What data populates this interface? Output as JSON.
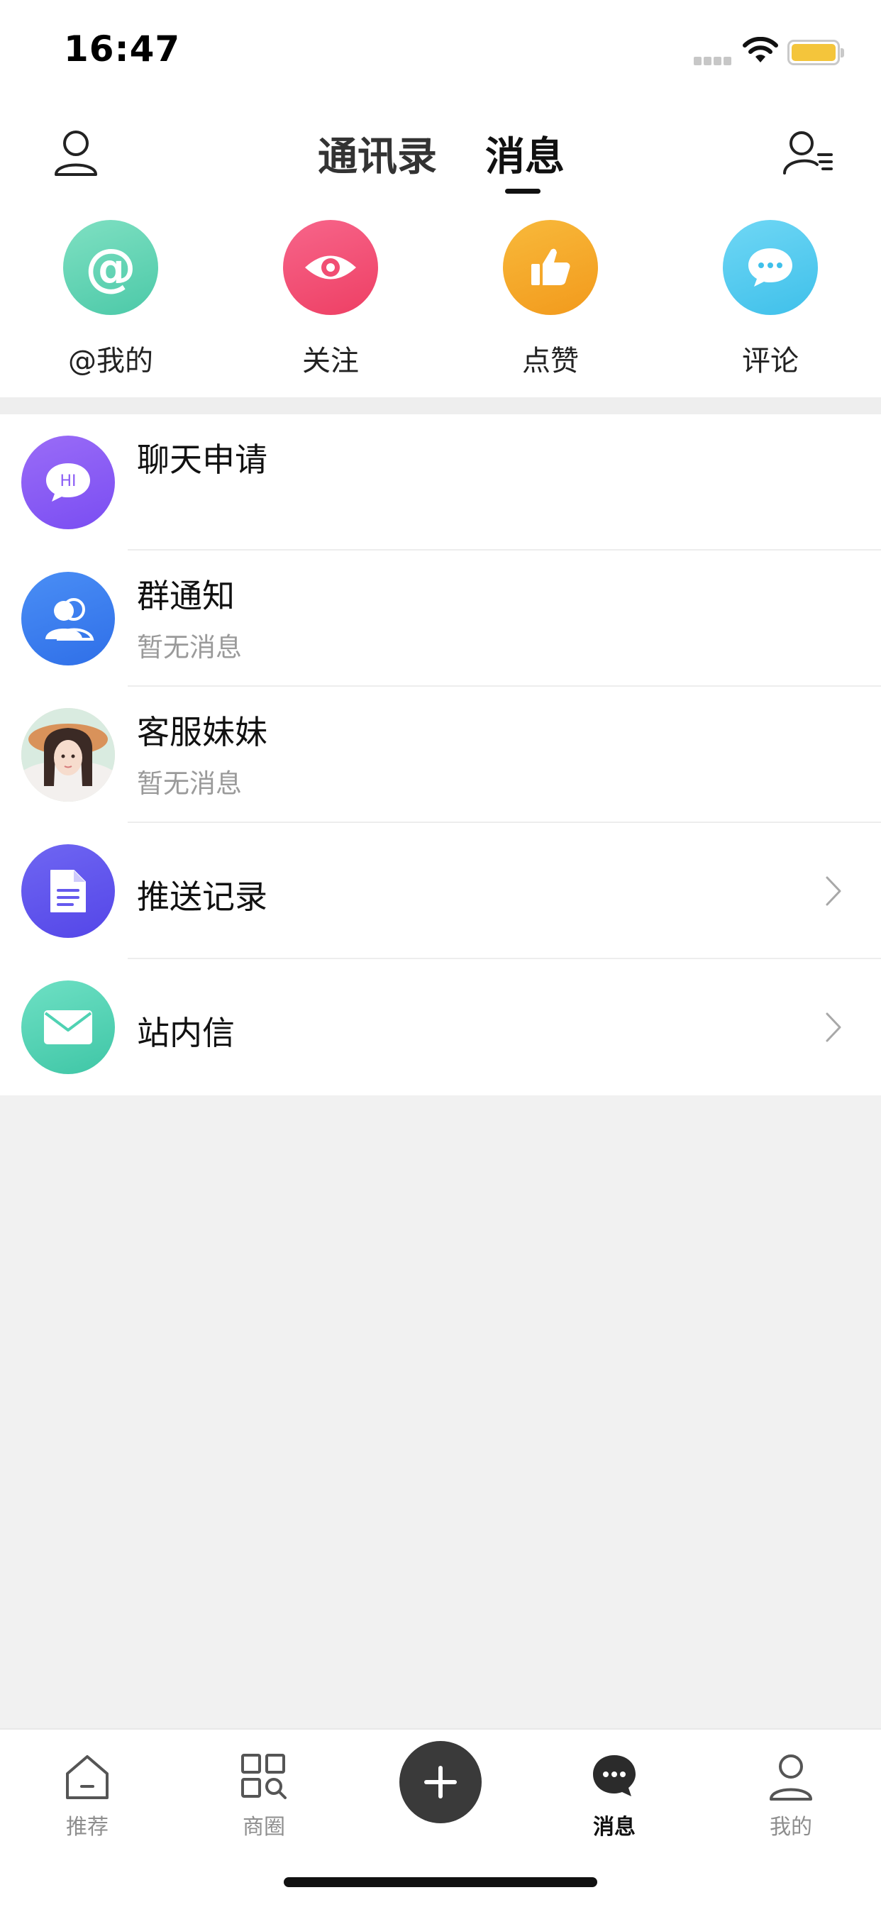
{
  "status_bar": {
    "time": "16:47"
  },
  "header": {
    "tabs": [
      {
        "label": "通讯录",
        "active": false
      },
      {
        "label": "消息",
        "active": true
      }
    ]
  },
  "quick_actions": [
    {
      "label": "@我的",
      "icon": "at-icon",
      "color": "#5fd3b5"
    },
    {
      "label": "关注",
      "icon": "eye-icon",
      "color": "#f14e73"
    },
    {
      "label": "点赞",
      "icon": "thumbs-up-icon",
      "color": "#f5a524"
    },
    {
      "label": "评论",
      "icon": "comment-icon",
      "color": "#4fc9ee"
    }
  ],
  "messages": [
    {
      "title": "聊天申请",
      "subtitle": "",
      "icon": "hi-bubble-icon",
      "color": "#8a5cf5",
      "chevron": false
    },
    {
      "title": "群通知",
      "subtitle": "暂无消息",
      "icon": "group-icon",
      "color": "#3a7cf0",
      "chevron": false
    },
    {
      "title": "客服妹妹",
      "subtitle": "暂无消息",
      "icon": "support-avatar",
      "color": "#e8d6c8",
      "chevron": false
    },
    {
      "title": "推送记录",
      "subtitle": "",
      "icon": "document-icon",
      "color": "#6559ee",
      "chevron": true
    },
    {
      "title": "站内信",
      "subtitle": "",
      "icon": "envelope-icon",
      "color": "#4fd2b3",
      "chevron": true
    }
  ],
  "tab_bar": {
    "items": [
      {
        "label": "推荐",
        "icon": "home-icon",
        "active": false
      },
      {
        "label": "商圈",
        "icon": "grid-search-icon",
        "active": false
      },
      {
        "label": "消息",
        "icon": "chat-dots-icon",
        "active": true
      },
      {
        "label": "我的",
        "icon": "user-icon",
        "active": false
      }
    ],
    "plus_icon": "plus-icon"
  }
}
